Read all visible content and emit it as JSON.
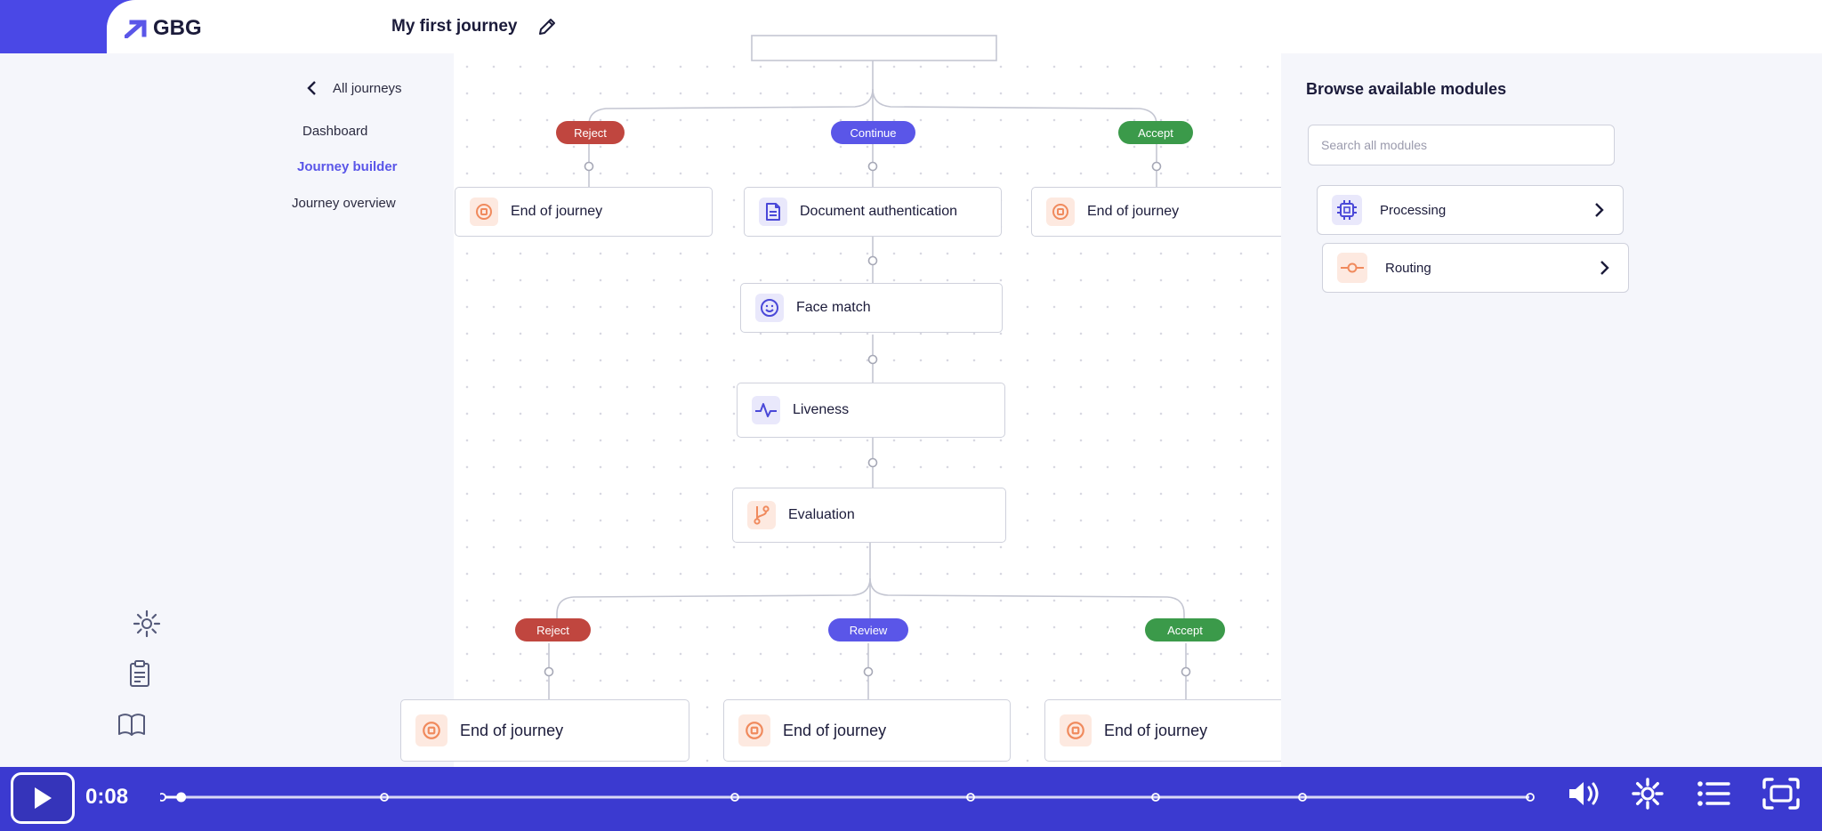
{
  "brand": {
    "name": "GBG"
  },
  "journey": {
    "title": "My first journey"
  },
  "subnav": {
    "back_label": "All journeys",
    "items": [
      {
        "label": "Dashboard"
      },
      {
        "label": "Journey builder",
        "active": true
      },
      {
        "label": "Journey overview"
      }
    ]
  },
  "flow": {
    "pills": {
      "reject_top": "Reject",
      "continue_top": "Continue",
      "accept_top": "Accept",
      "reject_bottom": "Reject",
      "review_bottom": "Review",
      "accept_bottom": "Accept"
    },
    "nodes": {
      "end_top_left": "End of journey",
      "doc_auth": "Document authentication",
      "end_top_right": "End of journey",
      "face_match": "Face match",
      "liveness": "Liveness",
      "evaluation": "Evaluation",
      "end_bottom_left": "End of journey",
      "end_bottom_mid": "End of journey",
      "end_bottom_right": "End of journey"
    }
  },
  "panel": {
    "title": "Browse available modules",
    "search_placeholder": "Search all modules",
    "modules": [
      {
        "label": "Processing"
      },
      {
        "label": "Routing"
      }
    ]
  },
  "video": {
    "time": "0:08",
    "progress": 0.005
  },
  "colors": {
    "accent": "#5a56e8",
    "reject": "#c0463f",
    "continue": "#5a56e8",
    "accept": "#3b9a4a",
    "end_icon": "#f08a5d",
    "video_bg": "#3b3ad0"
  },
  "icons": {
    "rail": [
      "list-icon",
      "users-icon",
      "trending-up-icon",
      "team-icon",
      "settings-icon",
      "clipboard-icon",
      "book-icon"
    ],
    "modules": [
      "chip-icon",
      "route-icon"
    ],
    "controls": [
      "play-icon",
      "volume-icon",
      "settings-icon",
      "chapters-icon",
      "fullscreen-icon"
    ]
  }
}
